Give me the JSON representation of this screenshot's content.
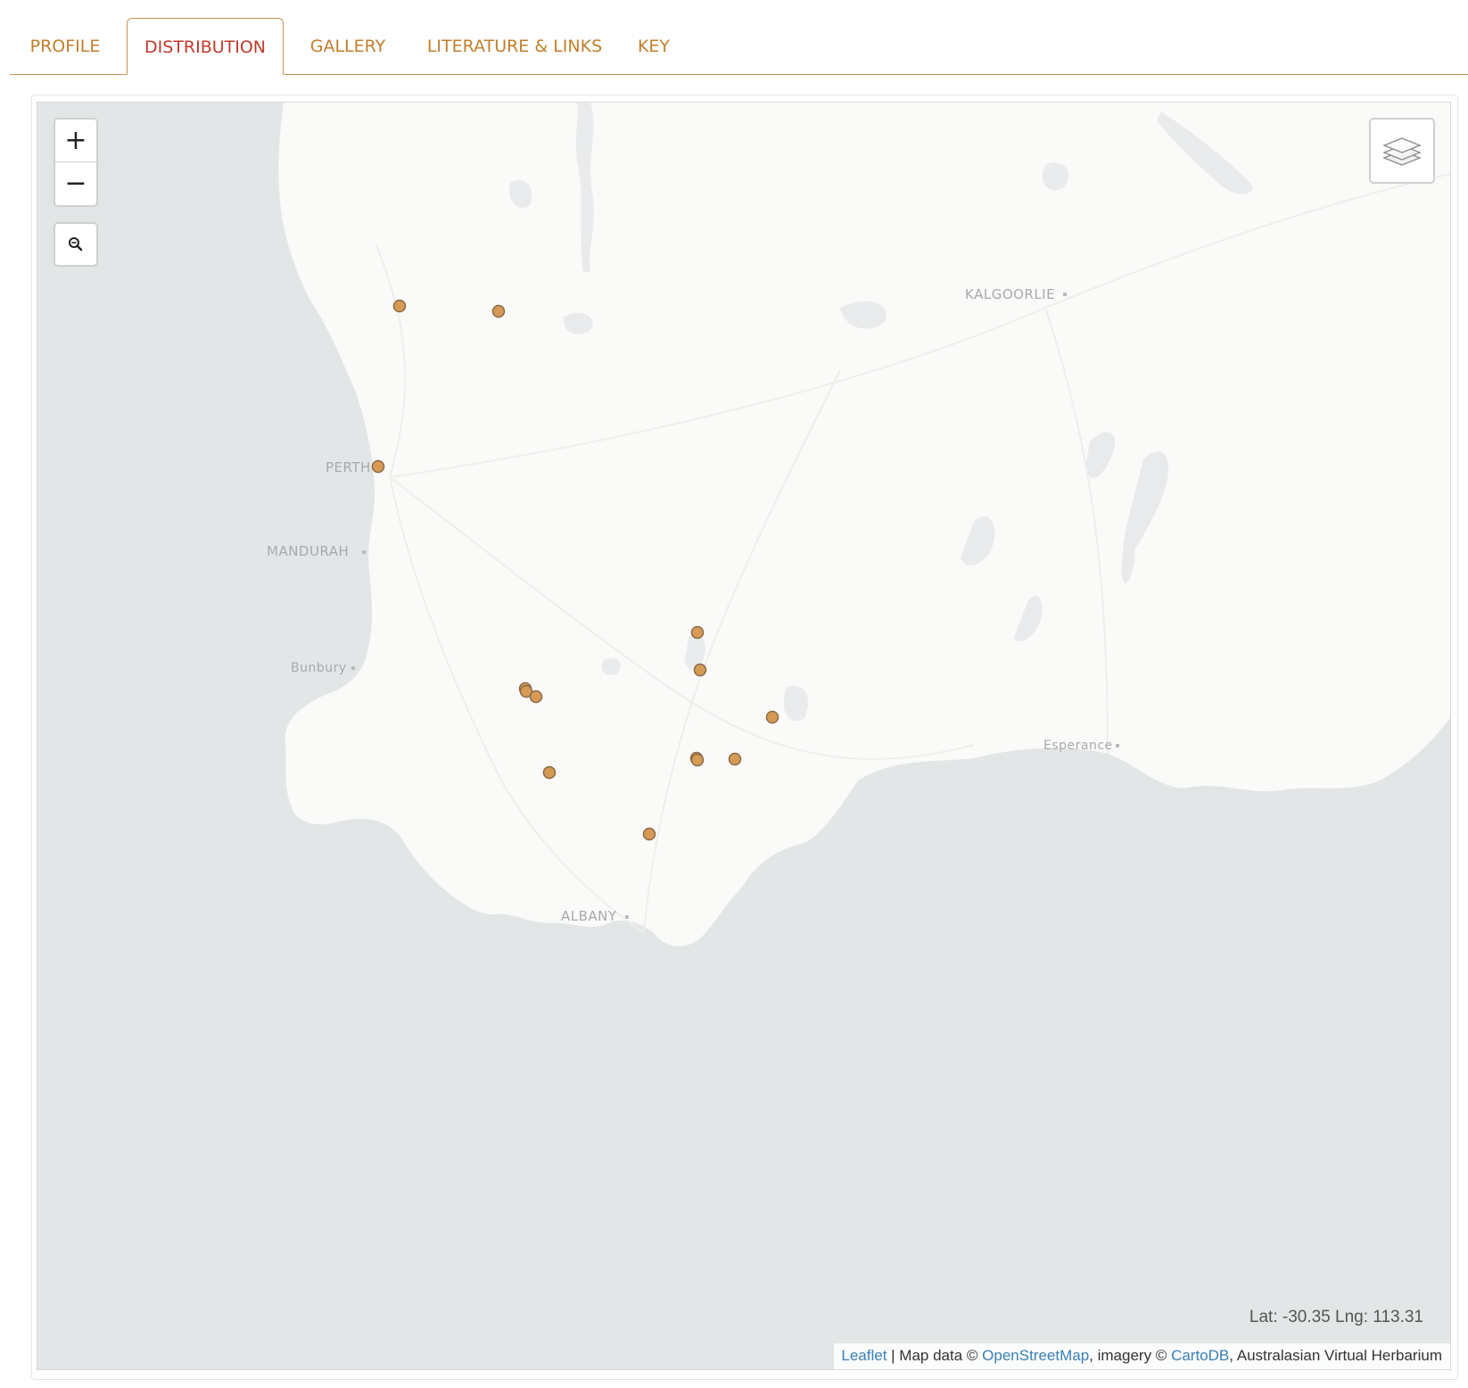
{
  "tabs": [
    {
      "label": "PROFILE"
    },
    {
      "label": "DISTRIBUTION"
    },
    {
      "label": "GALLERY"
    },
    {
      "label": "LITERATURE & LINKS"
    },
    {
      "label": "KEY"
    }
  ],
  "active_tab": "DISTRIBUTION",
  "map": {
    "zoom_in_label": "+",
    "zoom_out_label": "−",
    "cities": [
      "KALGOORLIE",
      "PERTH",
      "MANDURAH",
      "Bunbury",
      "Esperance",
      "ALBANY"
    ],
    "coords": "Lat: -30.35 Lng: 113.31",
    "attribution": {
      "leaflet": "Leaflet",
      "sep1": " | Map data © ",
      "osm": "OpenStreetMap",
      "sep2": ", imagery © ",
      "carto": "CartoDB",
      "sep3": ", Australasian Virtual Herbarium"
    },
    "occurrence_color": "#d79a55",
    "occurrence_count": 14,
    "land_color": "#fafaf9",
    "sea_color": "#e3e6e7"
  },
  "colors": {
    "tab_text": "#c07f2d",
    "tab_active": "#c0392b",
    "link": "#3a7fb4"
  }
}
